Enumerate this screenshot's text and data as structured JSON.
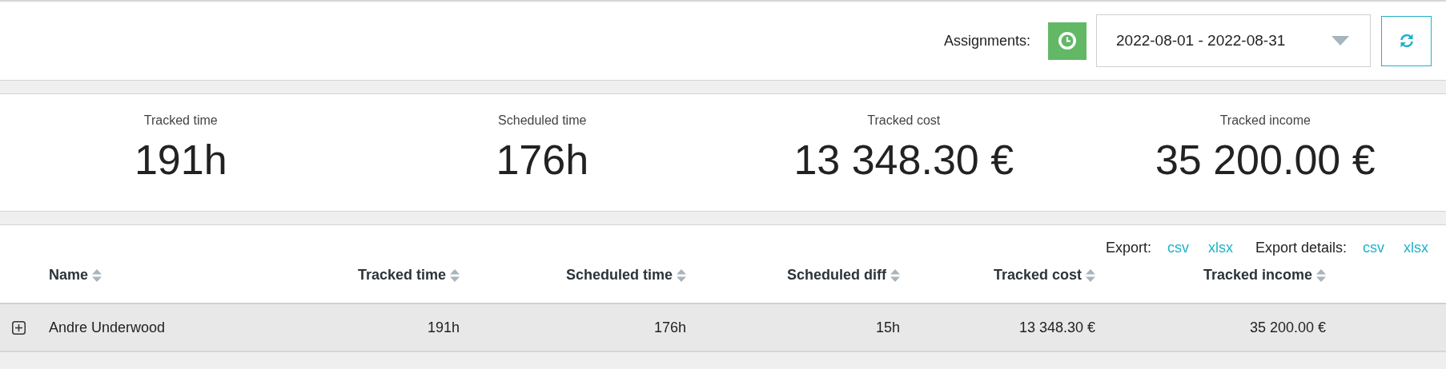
{
  "toolbar": {
    "label": "Assignments:",
    "date_range": "2022-08-01 - 2022-08-31"
  },
  "stats": [
    {
      "label": "Tracked time",
      "value": "191h"
    },
    {
      "label": "Scheduled time",
      "value": "176h"
    },
    {
      "label": "Tracked cost",
      "value": "13 348.30 €"
    },
    {
      "label": "Tracked income",
      "value": "35 200.00 €"
    }
  ],
  "exports": [
    {
      "label": "Export:",
      "links": [
        "csv",
        "xlsx"
      ]
    },
    {
      "label": "Export details:",
      "links": [
        "csv",
        "xlsx"
      ]
    }
  ],
  "table": {
    "columns": [
      "Name",
      "Tracked time",
      "Scheduled time",
      "Scheduled diff",
      "Tracked cost",
      "Tracked income"
    ],
    "rows": [
      {
        "expanded": false,
        "cells": [
          "Andre Underwood",
          "191h",
          "176h",
          "15h",
          "13 348.30 €",
          "35 200.00 €"
        ]
      }
    ]
  }
}
